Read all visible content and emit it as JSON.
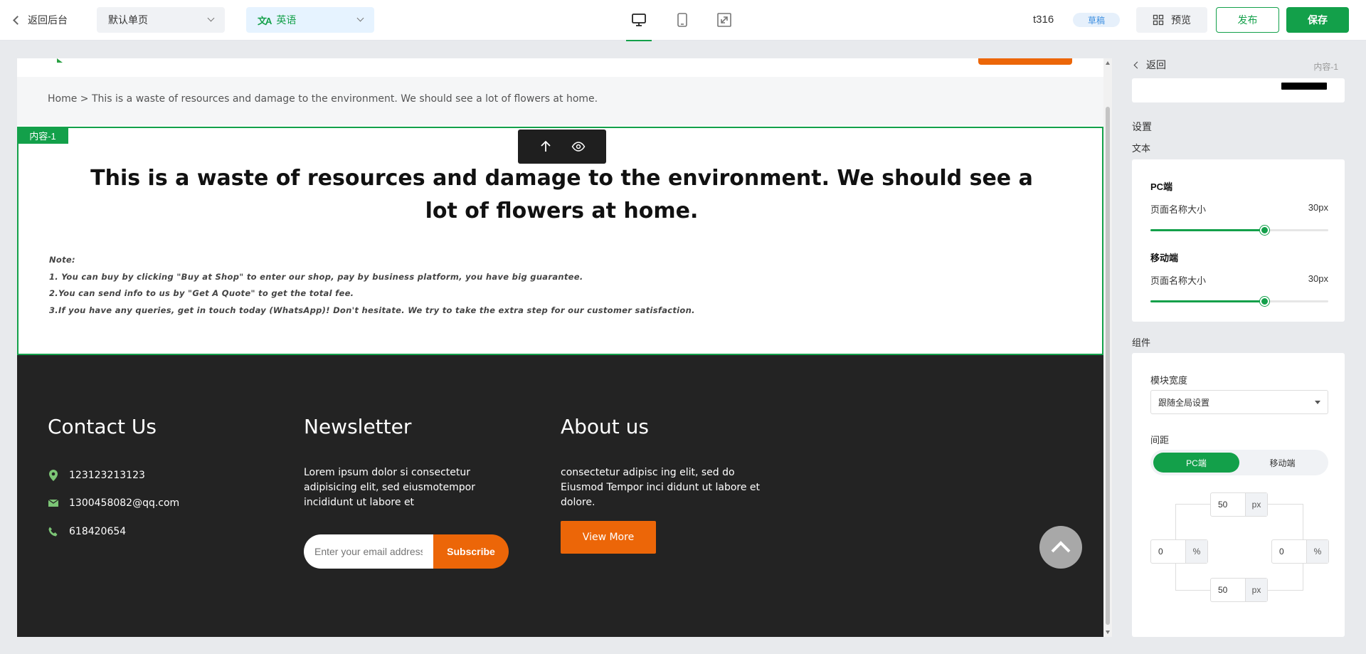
{
  "topbar": {
    "back_label": "返回后台",
    "page_select": "默认单页",
    "language_select": "英语",
    "page_id": "t316",
    "status_badge": "草稿",
    "preview_label": "预览",
    "publish_label": "发布",
    "save_label": "保存"
  },
  "canvas": {
    "breadcrumb": "Home > This is a waste of resources and damage to the environment. We should see a lot of flowers at home.",
    "content_tag": "内容-1",
    "title": "This is a waste of resources and damage to the environment. We should see a lot of flowers at home.",
    "note": {
      "label": "Note:",
      "line1": "1. You can buy by clicking \"Buy at Shop\" to enter our  shop, pay by business platform, you have big guarantee.",
      "line2": "2.You can send info to us by \"Get A Quote\" to get the total fee.",
      "line3": "3.If you have any queries, get in touch today (WhatsApp)! Don't hesitate. We try to take the extra step for our customer satisfaction."
    },
    "footer": {
      "contact": {
        "heading": "Contact Us",
        "address": "123123213123",
        "email": "1300458082@qq.com",
        "phone": "618420654"
      },
      "newsletter": {
        "heading": "Newsletter",
        "text": "Lorem ipsum dolor si consectetur adipisicing elit, sed eiusmotempor incididunt ut labore et",
        "email_placeholder": "Enter your email address",
        "subscribe_label": "Subscribe"
      },
      "about": {
        "heading": "About us",
        "text": "consectetur adipisc ing elit, sed do Eiusmod Tempor inci didunt ut labore et dolore.",
        "button_label": "View More"
      }
    }
  },
  "panel": {
    "back_label": "返回",
    "module_id": "内容-1",
    "settings_label": "设置",
    "text_label": "文本",
    "pc_label": "PC端",
    "pc_font_label": "页面名称大小",
    "pc_font_value": "30px",
    "pc_slider_level": 0.64,
    "mobile_label": "移动端",
    "mobile_font_label": "页面名称大小",
    "mobile_font_value": "30px",
    "mobile_slider_level": 0.64,
    "component_label": "组件",
    "width_label": "模块宽度",
    "width_value": "跟随全局设置",
    "spacing_label": "间距",
    "toggle_pc": "PC端",
    "toggle_mobile": "移动端",
    "spacing": {
      "top": "50",
      "top_unit": "px",
      "left": "0",
      "left_unit": "%",
      "right": "0",
      "right_unit": "%",
      "bottom": "50",
      "bottom_unit": "px"
    }
  },
  "colors": {
    "brand_green": "#13a04a",
    "accent_orange": "#ec6608",
    "footer_bg": "#232323"
  }
}
